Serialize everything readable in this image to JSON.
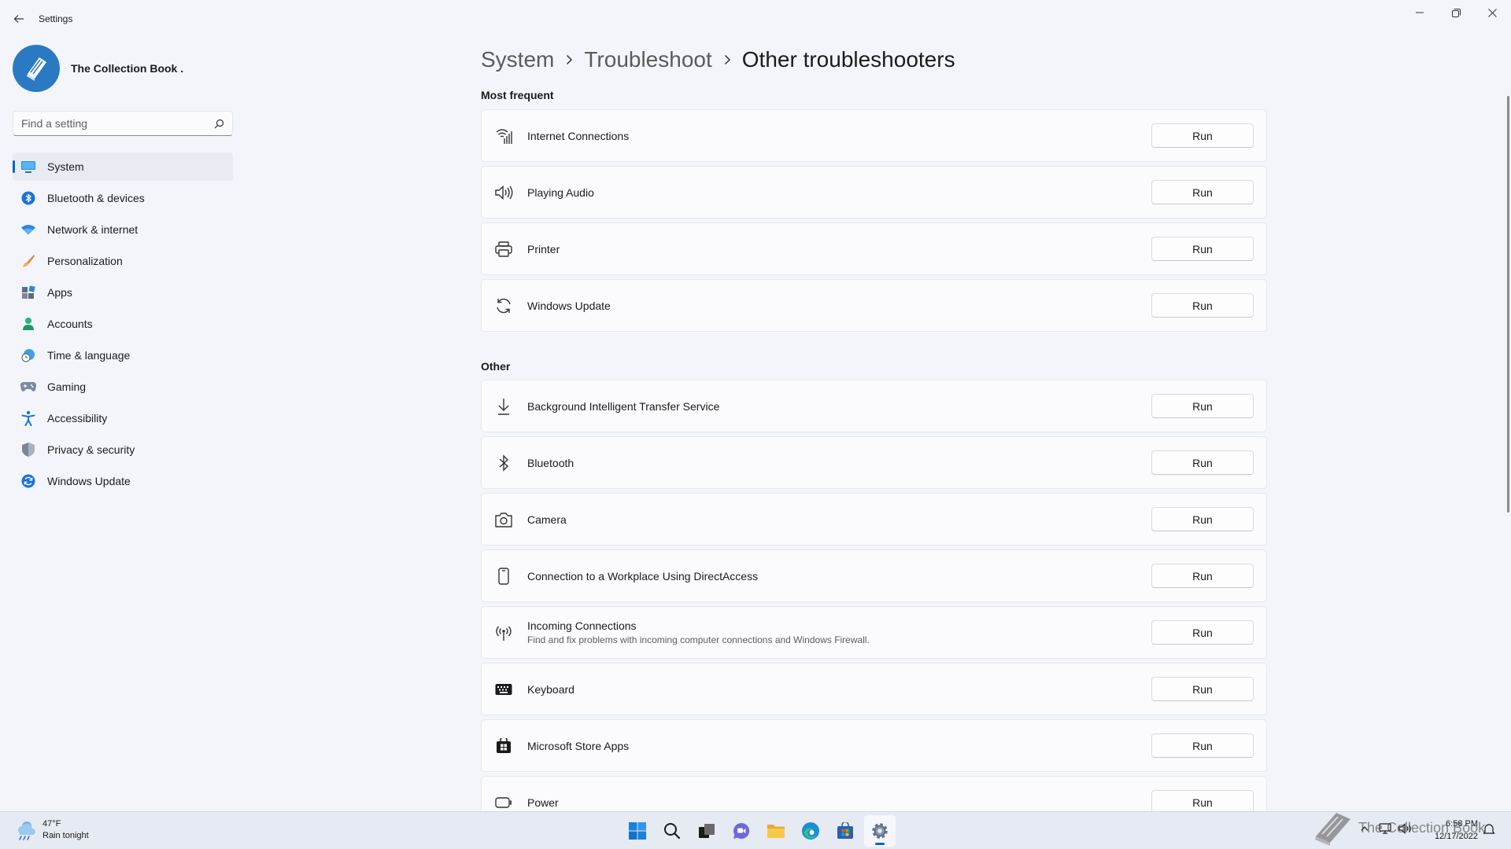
{
  "app": {
    "title": "Settings"
  },
  "profile": {
    "name": "The Collection Book ."
  },
  "search": {
    "placeholder": "Find a setting"
  },
  "nav": {
    "items": [
      {
        "label": "System",
        "icon": "system-icon",
        "active": true
      },
      {
        "label": "Bluetooth & devices",
        "icon": "bluetooth-icon"
      },
      {
        "label": "Network & internet",
        "icon": "wifi-icon"
      },
      {
        "label": "Personalization",
        "icon": "brush-icon"
      },
      {
        "label": "Apps",
        "icon": "apps-icon"
      },
      {
        "label": "Accounts",
        "icon": "person-icon"
      },
      {
        "label": "Time & language",
        "icon": "globe-clock-icon"
      },
      {
        "label": "Gaming",
        "icon": "gamepad-icon"
      },
      {
        "label": "Accessibility",
        "icon": "accessibility-icon"
      },
      {
        "label": "Privacy & security",
        "icon": "shield-icon"
      },
      {
        "label": "Windows Update",
        "icon": "update-icon"
      }
    ]
  },
  "breadcrumb": {
    "items": [
      "System",
      "Troubleshoot",
      "Other troubleshooters"
    ]
  },
  "sections": {
    "most_frequent": {
      "title": "Most frequent",
      "items": [
        {
          "title": "Internet Connections",
          "icon": "wifi-signal-icon",
          "button": "Run"
        },
        {
          "title": "Playing Audio",
          "icon": "speaker-icon",
          "button": "Run"
        },
        {
          "title": "Printer",
          "icon": "printer-icon",
          "button": "Run"
        },
        {
          "title": "Windows Update",
          "icon": "refresh-icon",
          "button": "Run"
        }
      ]
    },
    "other": {
      "title": "Other",
      "items": [
        {
          "title": "Background Intelligent Transfer Service",
          "icon": "download-icon",
          "button": "Run"
        },
        {
          "title": "Bluetooth",
          "icon": "bluetooth-icon",
          "button": "Run"
        },
        {
          "title": "Camera",
          "icon": "camera-icon",
          "button": "Run"
        },
        {
          "title": "Connection to a Workplace Using DirectAccess",
          "icon": "phone-icon",
          "button": "Run"
        },
        {
          "title": "Incoming Connections",
          "description": "Find and fix problems with incoming computer connections and Windows Firewall.",
          "icon": "antenna-icon",
          "button": "Run"
        },
        {
          "title": "Keyboard",
          "icon": "keyboard-icon",
          "button": "Run"
        },
        {
          "title": "Microsoft Store Apps",
          "icon": "store-icon",
          "button": "Run"
        },
        {
          "title": "Power",
          "icon": "battery-icon",
          "button": "Run"
        }
      ]
    }
  },
  "taskbar": {
    "weather": {
      "temp": "47°F",
      "condition": "Rain tonight"
    },
    "apps": [
      "windows-start-icon",
      "search-icon",
      "task-view-icon",
      "chat-icon",
      "file-explorer-icon",
      "edge-icon",
      "store-icon",
      "settings-gear-icon"
    ],
    "clock": {
      "time": "6:58 PM",
      "date": "12/17/2022"
    }
  },
  "watermark": {
    "text": "The Collection Book"
  },
  "colors": {
    "accent": "#0067c0",
    "background": "#f3f5fb",
    "card": "#fbfbfd"
  }
}
